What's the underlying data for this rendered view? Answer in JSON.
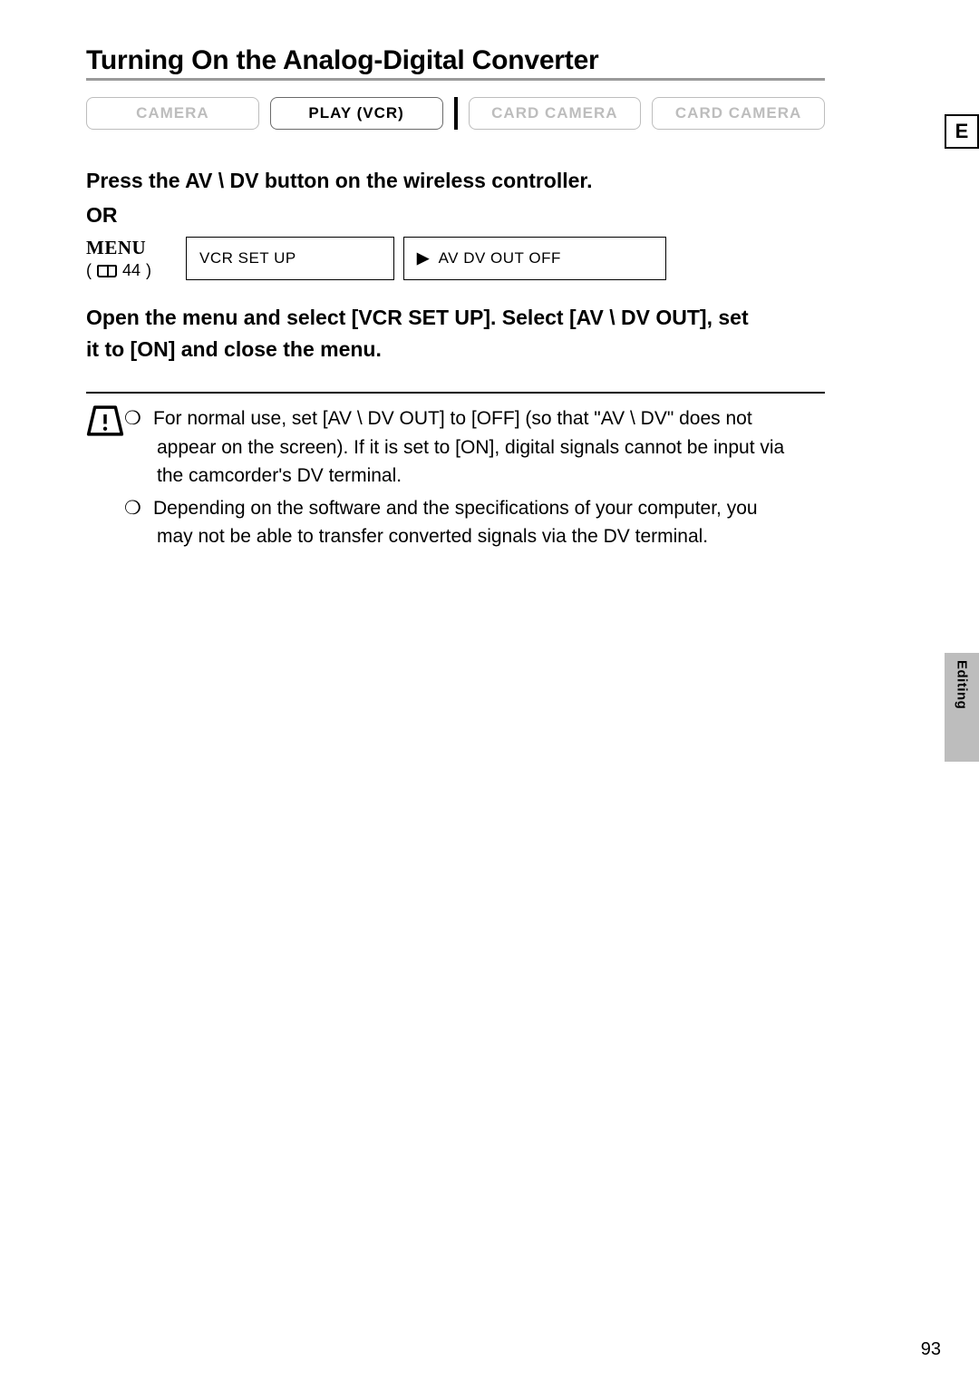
{
  "title": "Turning On the Analog-Digital Converter",
  "modes": {
    "camera": "CAMERA",
    "play_vcr": "PLAY (VCR)",
    "card_camera_1": "CARD CAMERA",
    "card_camera_2": "CARD CAMERA"
  },
  "step1": "Press the AV \\   DV button on the wireless controller.",
  "or": "OR",
  "menu": {
    "label": "MENU",
    "ref": "44",
    "box1": "VCR SET UP",
    "box2": "AV   DV OUT  OFF"
  },
  "step2": "Open the menu and select [VCR SET UP]. Select [AV \\   DV OUT], set it to [ON] and close the menu.",
  "notes": {
    "n1": "For normal use, set [AV \\   DV OUT] to [OFF] (so that \"AV \\   DV\" does not appear on the screen). If it is set to [ON], digital signals cannot be input via the camcorder's DV terminal.",
    "n2": "Depending on the software and the specifications of your computer, you may not be able to transfer converted signals via the DV terminal."
  },
  "side": {
    "lang": "E",
    "section": "Editing"
  },
  "page_number": "93"
}
